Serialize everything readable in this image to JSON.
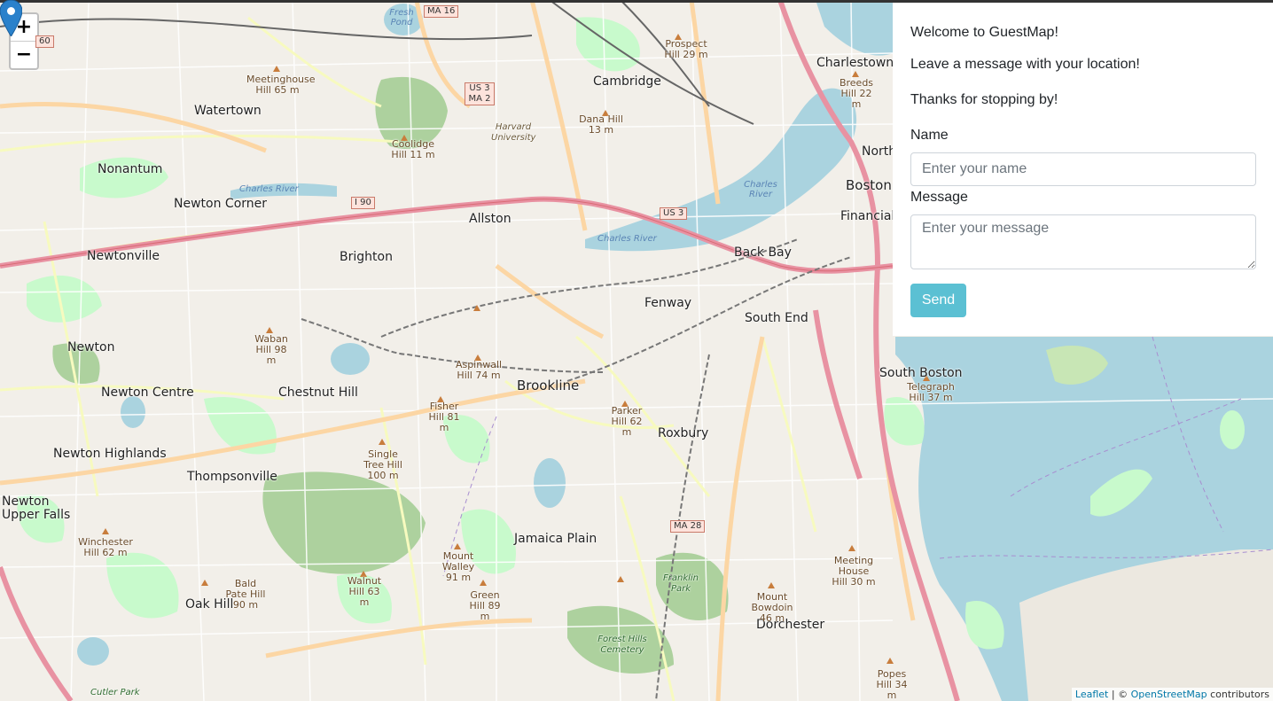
{
  "map": {
    "zoom_in": "+",
    "zoom_out": "−",
    "places": [
      {
        "name": "Watertown",
        "type": "big"
      },
      {
        "name": "Cambridge",
        "type": "big"
      },
      {
        "name": "Charlestown",
        "type": "big"
      },
      {
        "name": "Boston",
        "type": "big"
      },
      {
        "name": "Nonantum",
        "type": "big"
      },
      {
        "name": "Newton Corner",
        "type": "big"
      },
      {
        "name": "Allston",
        "type": "big"
      },
      {
        "name": "Brighton",
        "type": "big"
      },
      {
        "name": "Newtonville",
        "type": "big"
      },
      {
        "name": "Back Bay",
        "type": "big"
      },
      {
        "name": "Fenway",
        "type": "big"
      },
      {
        "name": "South End",
        "type": "big"
      },
      {
        "name": "Newton",
        "type": "big"
      },
      {
        "name": "Newton Centre",
        "type": "big"
      },
      {
        "name": "Chestnut Hill",
        "type": "big"
      },
      {
        "name": "Brookline",
        "type": "big"
      },
      {
        "name": "South Boston",
        "type": "big"
      },
      {
        "name": "Roxbury",
        "type": "big"
      },
      {
        "name": "Newton Highlands",
        "type": "big"
      },
      {
        "name": "Thompsonville",
        "type": "big"
      },
      {
        "name": "Newton Upper Falls",
        "type": "big"
      },
      {
        "name": "Jamaica Plain",
        "type": "big"
      },
      {
        "name": "Oak Hill",
        "type": "big"
      },
      {
        "name": "Dorchester",
        "type": "big"
      },
      {
        "name": "Financial D",
        "type": "big"
      },
      {
        "name": "North",
        "type": "big"
      }
    ],
    "hills": [
      "Meetinghouse Hill 65 m",
      "Coolidge Hill 11 m",
      "Dana Hill 13 m",
      "Prospect Hill 29 m",
      "Breeds Hill 22 m",
      "Waban Hill 98 m",
      "Aspinwall Hill 74 m",
      "Fisher Hill 81 m",
      "Parker Hill 62 m",
      "Single Tree Hill 100 m",
      "Telegraph Hill 37 m",
      "Winchester Hill 62 m",
      "Mount Walley 91 m",
      "Bald Pate Hill 90 m",
      "Walnut Hill 63 m",
      "Green Hill 89 m",
      "Mount Bowdoin 46 m",
      "Meeting House Hill 30 m",
      "Popes Hill 34 m"
    ],
    "shields": [
      "MA 16",
      "US 3 MA 2",
      "I 90",
      "US 3",
      "MA 28",
      "60"
    ],
    "water_labels": [
      "Fresh Pond",
      "Charles River",
      "Charles River",
      "Charles River"
    ],
    "other_labels": [
      "Harvard University",
      "Franklin Park",
      "Forest Hills Cemetery",
      "Cutler Park"
    ]
  },
  "panel": {
    "welcome": "Welcome to GuestMap!",
    "instruction": "Leave a message with your location!",
    "thanks": "Thanks for stopping by!",
    "name_label": "Name",
    "name_placeholder": "Enter your name",
    "message_label": "Message",
    "message_placeholder": "Enter your message",
    "send_label": "Send"
  },
  "attribution": {
    "leaflet": "Leaflet",
    "separator": " | © ",
    "osm": "OpenStreetMap",
    "suffix": " contributors"
  },
  "colors": {
    "send_button": "#5bc0d3",
    "marker": "#2a81cb",
    "water": "#aad3df",
    "park": "#c8facc"
  }
}
